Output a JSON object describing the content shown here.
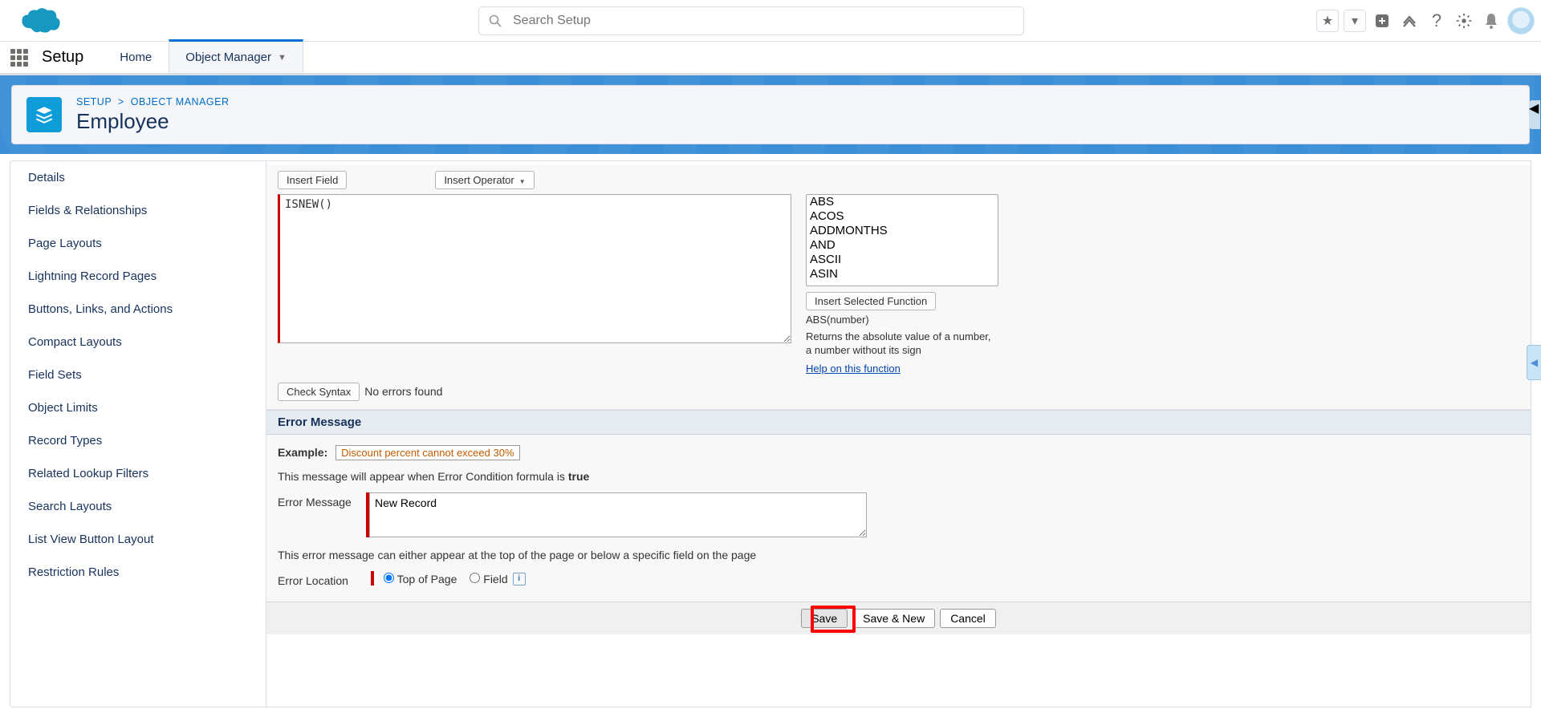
{
  "header": {
    "search_placeholder": "Search Setup"
  },
  "contextBar": {
    "app": "Setup",
    "tabs": [
      {
        "label": "Home",
        "active": false
      },
      {
        "label": "Object Manager",
        "active": true
      }
    ]
  },
  "breadcrumb": {
    "root": "SETUP",
    "leaf": "OBJECT MANAGER"
  },
  "pageTitle": "Employee",
  "sidebar": {
    "items": [
      "Details",
      "Fields & Relationships",
      "Page Layouts",
      "Lightning Record Pages",
      "Buttons, Links, and Actions",
      "Compact Layouts",
      "Field Sets",
      "Object Limits",
      "Record Types",
      "Related Lookup Filters",
      "Search Layouts",
      "List View Button Layout",
      "Restriction Rules"
    ]
  },
  "formula": {
    "insertField": "Insert Field",
    "insertOperator": "Insert Operator",
    "text": "ISNEW()",
    "checkSyntax": "Check Syntax",
    "syntaxMsg": "No errors found",
    "functions": [
      "ABS",
      "ACOS",
      "ADDMONTHS",
      "AND",
      "ASCII",
      "ASIN"
    ],
    "insertSelected": "Insert Selected Function",
    "funcSig": "ABS(number)",
    "funcDesc": "Returns the absolute value of a number, a number without its sign",
    "helpLink": "Help on this function"
  },
  "errorSection": {
    "header": "Error Message",
    "exampleLabel": "Example:",
    "exampleText": "Discount percent cannot exceed 30%",
    "note1a": "This message will appear when Error Condition formula is ",
    "note1b": "true",
    "msgLabel": "Error Message",
    "msgValue": "New Record",
    "note2": "This error message can either appear at the top of the page or below a specific field on the page",
    "locLabel": "Error Location",
    "opt1": "Top of Page",
    "opt2": "Field"
  },
  "buttons": {
    "save": "Save",
    "saveNew": "Save & New",
    "cancel": "Cancel"
  }
}
